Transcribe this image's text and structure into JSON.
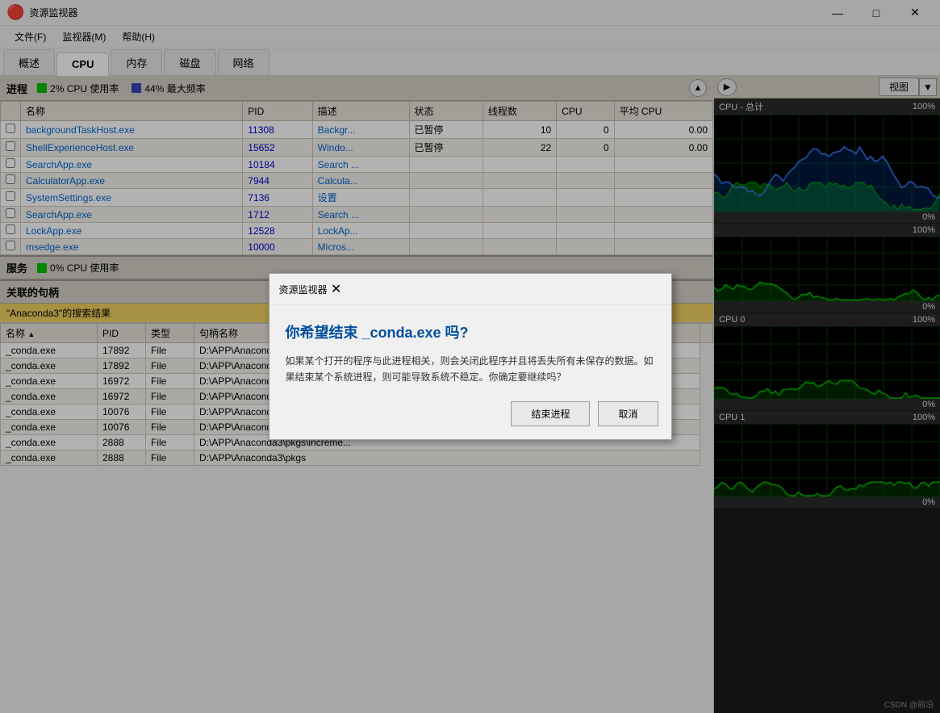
{
  "titleBar": {
    "icon": "🔴",
    "title": "资源监视器",
    "minimize": "—",
    "maximize": "□",
    "close": "✕"
  },
  "menuBar": {
    "items": [
      "文件(F)",
      "监视器(M)",
      "帮助(H)"
    ]
  },
  "tabs": {
    "items": [
      "概述",
      "CPU",
      "内存",
      "磁盘",
      "网络"
    ],
    "active": 1
  },
  "processSection": {
    "title": "进程",
    "cpuStat": "2% CPU 使用率",
    "freqStat": "44% 最大频率",
    "columns": [
      "名称",
      "PID",
      "描述",
      "状态",
      "线程数",
      "CPU",
      "平均 CPU"
    ],
    "rows": [
      {
        "name": "backgroundTaskHost.exe",
        "pid": "11308",
        "desc": "Backgr...",
        "status": "已暂停",
        "threads": "10",
        "cpu": "0",
        "avgCpu": "0.00"
      },
      {
        "name": "ShellExperienceHost.exe",
        "pid": "15652",
        "desc": "Windo...",
        "status": "已暂停",
        "threads": "22",
        "cpu": "0",
        "avgCpu": "0.00"
      },
      {
        "name": "SearchApp.exe",
        "pid": "10184",
        "desc": "Search ...",
        "status": "",
        "threads": "",
        "cpu": "",
        "avgCpu": ""
      },
      {
        "name": "CalculatorApp.exe",
        "pid": "7944",
        "desc": "Calcula...",
        "status": "",
        "threads": "",
        "cpu": "",
        "avgCpu": ""
      },
      {
        "name": "SystemSettings.exe",
        "pid": "7136",
        "desc": "设置",
        "status": "",
        "threads": "",
        "cpu": "",
        "avgCpu": ""
      },
      {
        "name": "SearchApp.exe",
        "pid": "1712",
        "desc": "Search ...",
        "status": "",
        "threads": "",
        "cpu": "",
        "avgCpu": ""
      },
      {
        "name": "LockApp.exe",
        "pid": "12528",
        "desc": "LockAp...",
        "status": "",
        "threads": "",
        "cpu": "",
        "avgCpu": ""
      },
      {
        "name": "msedge.exe",
        "pid": "10000",
        "desc": "Micros...",
        "status": "",
        "threads": "",
        "cpu": "",
        "avgCpu": ""
      }
    ]
  },
  "servicesSection": {
    "title": "服务",
    "cpuStat": "0% CPU 使用率"
  },
  "handlesSection": {
    "title": "关联的句柄",
    "searchResult": "\"Anaconda3\"的搜索结果",
    "columns": [
      "名称",
      "PID",
      "类型",
      "句柄名称"
    ],
    "rows": [
      {
        "name": "_conda.exe",
        "pid": "17892",
        "type": "File",
        "handle": "D:\\APP\\Anaconda3\\pkgs\\fonttoo..."
      },
      {
        "name": "_conda.exe",
        "pid": "17892",
        "type": "File",
        "handle": "D:\\APP\\Anaconda3\\pkgs"
      },
      {
        "name": "_conda.exe",
        "pid": "16972",
        "type": "File",
        "handle": "D:\\APP\\Anaconda3\\pkgs"
      },
      {
        "name": "_conda.exe",
        "pid": "16972",
        "type": "File",
        "handle": "D:\\APP\\Anaconda3\\pkgs\\csssel..."
      },
      {
        "name": "_conda.exe",
        "pid": "10076",
        "type": "File",
        "handle": "D:\\APP\\Anaconda3\\pkgs\\inflectio..."
      },
      {
        "name": "_conda.exe",
        "pid": "10076",
        "type": "File",
        "handle": "D:\\APP\\Anaconda3\\pkgs"
      },
      {
        "name": "_conda.exe",
        "pid": "2888",
        "type": "File",
        "handle": "D:\\APP\\Anaconda3\\pkgs\\increme..."
      },
      {
        "name": "_conda.exe",
        "pid": "2888",
        "type": "File",
        "handle": "D:\\APP\\Anaconda3\\pkgs"
      }
    ]
  },
  "rightPanel": {
    "viewLabel": "视图",
    "charts": [
      {
        "id": "cpu-total",
        "label": "CPU - 总计",
        "percent": "100%",
        "bottomPercent": "0%"
      },
      {
        "id": "cpu-usage",
        "label": "",
        "percent": "100%",
        "bottomPercent": "0%"
      },
      {
        "id": "cpu-0",
        "label": "CPU 0",
        "percent": "100%",
        "bottomPercent": "0%"
      },
      {
        "id": "cpu-1",
        "label": "CPU 1",
        "percent": "100%",
        "bottomPercent": "0%"
      }
    ]
  },
  "dialog": {
    "title": "资源监视器",
    "heading": "你希望结束 _conda.exe 吗?",
    "body": "如果某个打开的程序与此进程相关，则会关闭此程序并且将丢失所有未保存的数据。如果结束某个系统进程，则可能导致系统不稳定。你确定要继续吗？",
    "confirmBtn": "结束进程",
    "cancelBtn": "取消"
  },
  "watermark": "CSDN @前沿"
}
